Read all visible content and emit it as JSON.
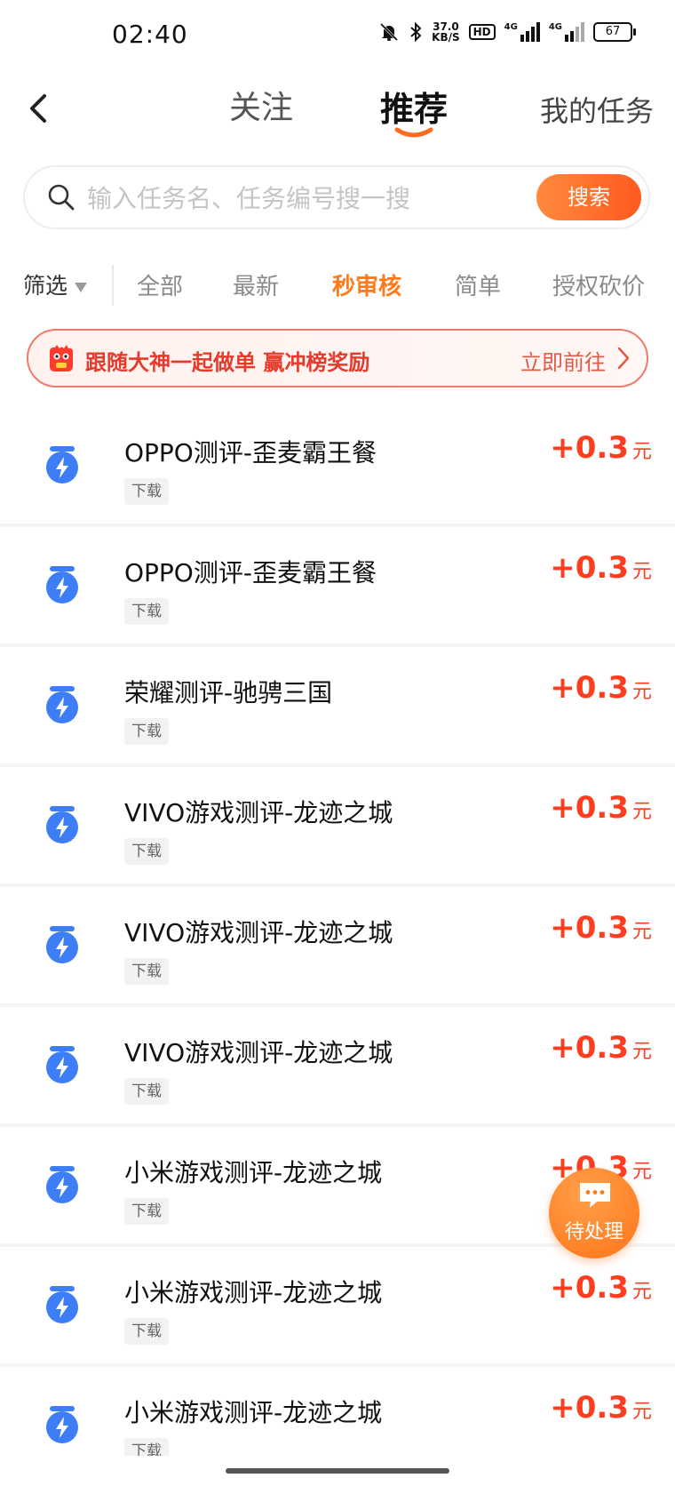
{
  "status_bar": {
    "time": "02:40",
    "net_speed_value": "37.0",
    "net_speed_unit": "KB/S",
    "hd_label": "HD",
    "signal1_label": "4G",
    "signal2_label": "4G",
    "battery": "67"
  },
  "header": {
    "tabs": [
      {
        "label": "关注"
      },
      {
        "label": "推荐"
      }
    ],
    "my_tasks": "我的任务",
    "accent_color": "#ff6a1f"
  },
  "search": {
    "placeholder": "输入任务名、任务编号搜一搜",
    "button_label": "搜索"
  },
  "filters": {
    "filter_label": "筛选",
    "chips": [
      {
        "label": "全部"
      },
      {
        "label": "最新"
      },
      {
        "label": "秒审核"
      },
      {
        "label": "简单"
      },
      {
        "label": "授权砍价"
      }
    ],
    "active_index": 2
  },
  "banner": {
    "text": "跟随大神一起做单 赢冲榜奖励",
    "link": "立即前往"
  },
  "tasks": [
    {
      "title": "OPPO测评-歪麦霸王餐",
      "tag": "下载",
      "reward": "+0.3",
      "unit": "元"
    },
    {
      "title": "OPPO测评-歪麦霸王餐",
      "tag": "下载",
      "reward": "+0.3",
      "unit": "元"
    },
    {
      "title": "荣耀测评-驰骋三国",
      "tag": "下载",
      "reward": "+0.3",
      "unit": "元"
    },
    {
      "title": "VIVO游戏测评-龙迹之城",
      "tag": "下载",
      "reward": "+0.3",
      "unit": "元"
    },
    {
      "title": "VIVO游戏测评-龙迹之城",
      "tag": "下载",
      "reward": "+0.3",
      "unit": "元"
    },
    {
      "title": "VIVO游戏测评-龙迹之城",
      "tag": "下载",
      "reward": "+0.3",
      "unit": "元"
    },
    {
      "title": "小米游戏测评-龙迹之城",
      "tag": "下载",
      "reward": "+0.3",
      "unit": "元"
    },
    {
      "title": "小米游戏测评-龙迹之城",
      "tag": "下载",
      "reward": "+0.3",
      "unit": "元"
    },
    {
      "title": "小米游戏测评-龙迹之城",
      "tag": "下载",
      "reward": "+0.3",
      "unit": "元"
    }
  ],
  "fab": {
    "label": "待处理",
    "icon": "chat-bubble-icon"
  }
}
